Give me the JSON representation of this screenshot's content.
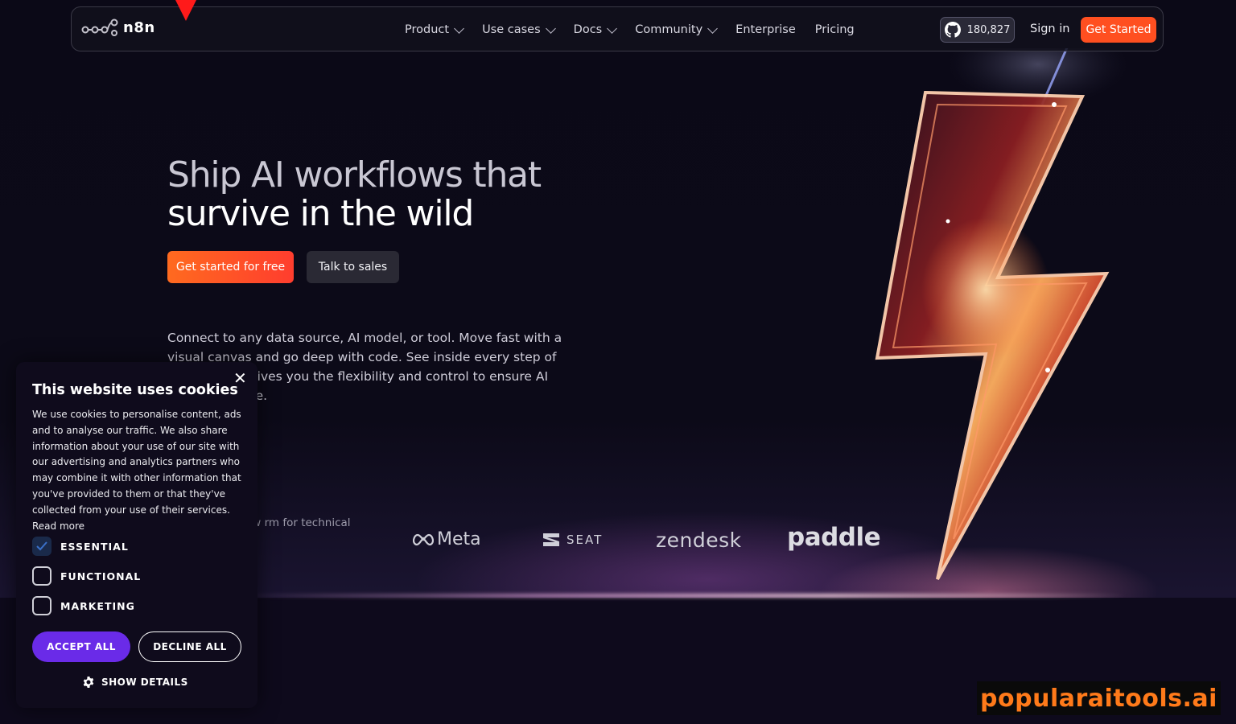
{
  "nav": {
    "brand": "n8n",
    "links": [
      {
        "label": "Product",
        "dropdown": true
      },
      {
        "label": "Use cases",
        "dropdown": true
      },
      {
        "label": "Docs",
        "dropdown": true
      },
      {
        "label": "Community",
        "dropdown": true
      },
      {
        "label": "Enterprise",
        "dropdown": false
      },
      {
        "label": "Pricing",
        "dropdown": false
      }
    ],
    "github_stars": "180,827",
    "sign_in": "Sign in",
    "get_started": "Get Started"
  },
  "hero": {
    "headline_line1": "Ship AI workflows that",
    "headline_line2": "survive in the wild",
    "cta_primary": "Get started for free",
    "cta_secondary": "Talk to sales",
    "description": "Connect to any data source, AI model, or tool. Move fast with a visual canvas and go deep with code. See inside every step of your agents' gives you the flexibility and control to ensure AI stays you scale.",
    "trusted_text": "popular workflow rm for technical"
  },
  "logos": {
    "meta": "Meta",
    "seat": "SEAT",
    "zendesk": "zendesk",
    "paddle": "paddle"
  },
  "cookie": {
    "title": "This website uses cookies",
    "body": "We use cookies to personalise content, ads and to analyse our traffic. We also share information about your use of our site with our advertising and analytics partners who may combine it with other information that you've provided to them or that they've collected from your use of their services. Read more",
    "options": [
      {
        "label": "ESSENTIAL",
        "checked": true
      },
      {
        "label": "FUNCTIONAL",
        "checked": false
      },
      {
        "label": "MARKETING",
        "checked": false
      }
    ],
    "accept_all": "ACCEPT ALL",
    "decline_all": "DECLINE ALL",
    "show_details": "SHOW DETAILS"
  },
  "watermark": "popularaitools.ai",
  "colors": {
    "accent_orange": "#ff4f20",
    "cookie_accept_purple": "#6a2be8",
    "background": "#0e0a1c"
  }
}
